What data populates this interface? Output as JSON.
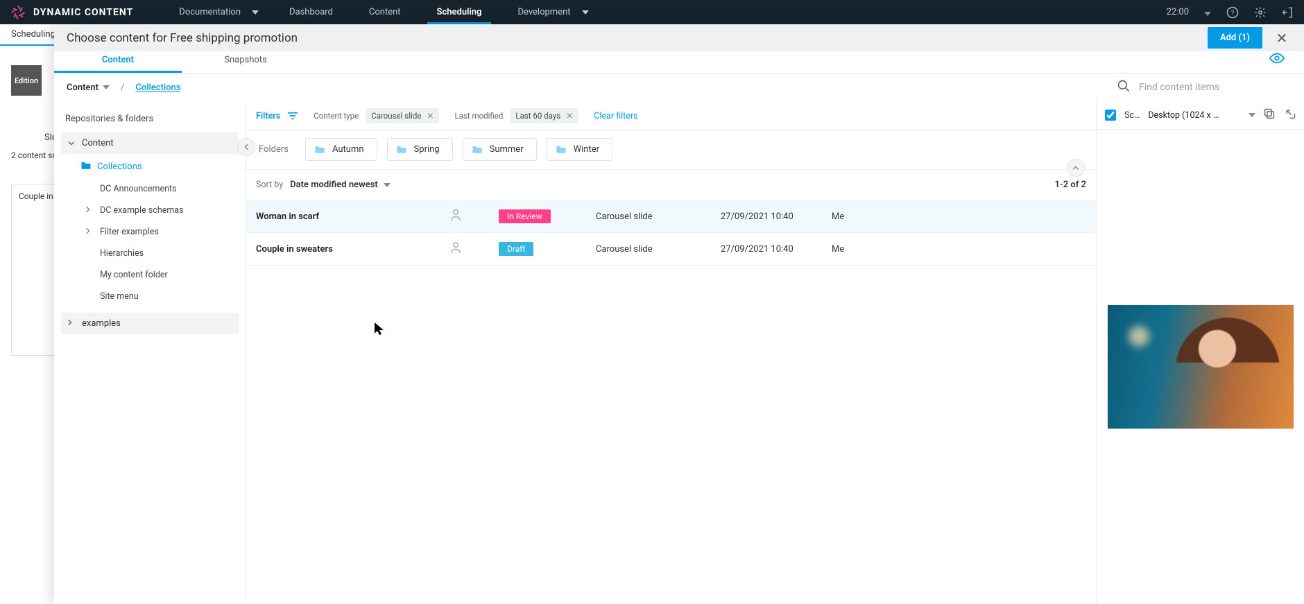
{
  "brand": "DYNAMIC CONTENT",
  "nav": {
    "items": [
      {
        "label": "Documentation",
        "caret": true,
        "active": false
      },
      {
        "label": "Dashboard",
        "caret": false,
        "active": false
      },
      {
        "label": "Content",
        "caret": false,
        "active": false
      },
      {
        "label": "Scheduling",
        "caret": false,
        "active": true
      },
      {
        "label": "Development",
        "caret": true,
        "active": false
      }
    ],
    "time": "22:00"
  },
  "background": {
    "sidebarTab": "Scheduling",
    "editionBadge": "Edition",
    "slotsTab": "Slo",
    "snapshotsLine": "2 content sn",
    "cardTitle": "Couple in"
  },
  "modal": {
    "title": "Choose content for Free shipping promotion",
    "addBtn": "Add (1)",
    "tabs": {
      "content": "Content",
      "snapshots": "Snapshots"
    },
    "breadcrumb": {
      "content": "Content",
      "collections": "Collections"
    },
    "searchPlaceholder": "Find content items",
    "sidebar": {
      "title": "Repositories & folders",
      "rootContent": "Content",
      "collections": "Collections",
      "items": [
        {
          "label": "DC Announcements",
          "expandable": false
        },
        {
          "label": "DC example schemas",
          "expandable": true
        },
        {
          "label": "Filter examples",
          "expandable": true
        },
        {
          "label": "Hierarchies",
          "expandable": false
        },
        {
          "label": "My content folder",
          "expandable": false
        },
        {
          "label": "Site menu",
          "expandable": false
        }
      ],
      "examples": "examples"
    },
    "filters": {
      "label": "Filters",
      "contentTypeKey": "Content type",
      "contentTypeChip": "Carousel slide",
      "lastModifiedKey": "Last modified",
      "lastModifiedChip": "Last 60 days",
      "clear": "Clear filters"
    },
    "folders": {
      "label": "Folders",
      "list": [
        "Autumn",
        "Spring",
        "Summer",
        "Winter"
      ]
    },
    "sort": {
      "by": "Sort by",
      "value": "Date modified newest",
      "count": "1-2 of 2"
    },
    "rows": [
      {
        "name": "Woman in scarf",
        "status": "In Review",
        "statusClass": "review",
        "type": "Carousel slide",
        "date": "27/09/2021 10:40",
        "author": "Me",
        "selected": true
      },
      {
        "name": "Couple in sweaters",
        "status": "Draft",
        "statusClass": "draft",
        "type": "Carousel slide",
        "date": "27/09/2021 10:40",
        "author": "Me",
        "selected": false
      }
    ],
    "preview": {
      "scLabel": "Sc…",
      "device": "Desktop (1024 x …"
    }
  }
}
